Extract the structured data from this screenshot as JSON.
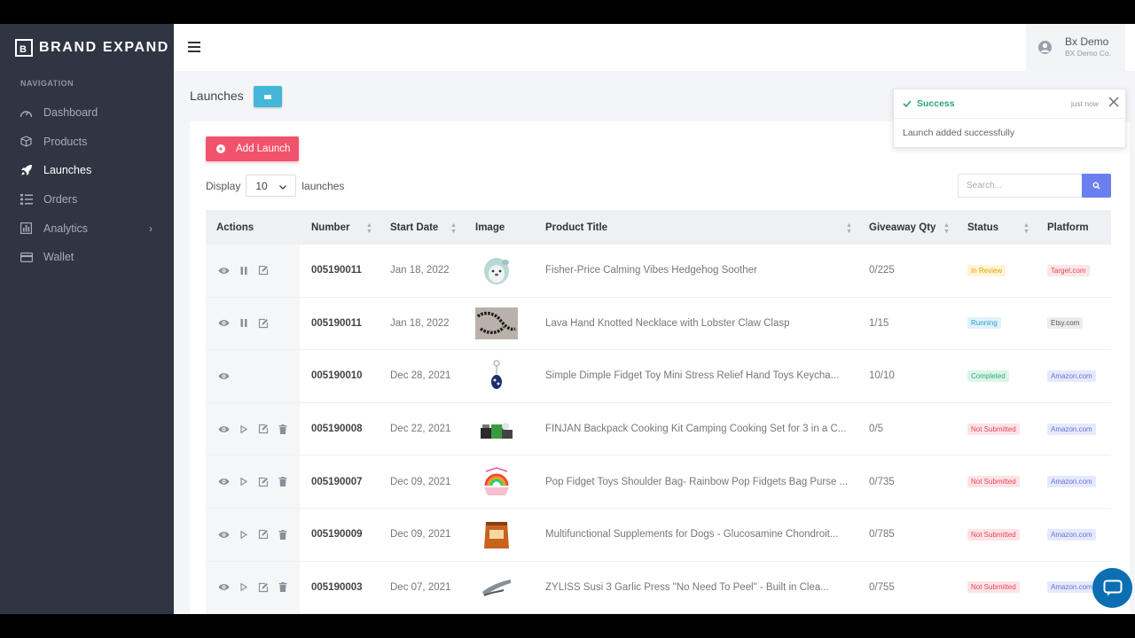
{
  "brand": {
    "name": "BRAND EXPAND",
    "mark": "B"
  },
  "sidebar": {
    "heading": "NAVIGATION",
    "items": [
      {
        "label": "Dashboard",
        "icon": "gauge-icon"
      },
      {
        "label": "Products",
        "icon": "box-icon"
      },
      {
        "label": "Launches",
        "icon": "rocket-icon",
        "active": true
      },
      {
        "label": "Orders",
        "icon": "list-icon"
      },
      {
        "label": "Analytics",
        "icon": "chart-icon",
        "has_children": true
      },
      {
        "label": "Wallet",
        "icon": "credit-card-icon"
      }
    ]
  },
  "user": {
    "name": "Bx Demo",
    "company": "BX Demo Co."
  },
  "page": {
    "title": "Launches"
  },
  "toolbar": {
    "add_label": "Add Launch",
    "display_label": "Display",
    "display_value": "10",
    "display_suffix": "launches",
    "search_placeholder": "Search..."
  },
  "table": {
    "columns": [
      "Actions",
      "Number",
      "Start Date",
      "Image",
      "Product Title",
      "Giveaway Qty",
      "Status",
      "Platform"
    ],
    "rows": [
      {
        "actions": [
          "eye",
          "pause",
          "edit"
        ],
        "number": "005190011",
        "date": "Jan 18, 2022",
        "image": "hedgehog-plush",
        "title": "Fisher-Price Calming Vibes Hedgehog Soother",
        "qty": "0/225",
        "status": "In Review",
        "platform": "Target.com"
      },
      {
        "actions": [
          "eye",
          "pause",
          "edit"
        ],
        "number": "005190011",
        "date": "Jan 18, 2022",
        "image": "necklace",
        "title": "Lava Hand Knotted Necklace with Lobster Claw Clasp",
        "qty": "1/15",
        "status": "Running",
        "platform": "Etsy.com"
      },
      {
        "actions": [
          "eye"
        ],
        "number": "005190010",
        "date": "Dec 28, 2021",
        "image": "fidget-keychain",
        "title": "Simple Dimple Fidget Toy Mini Stress Relief Hand Toys Keycha...",
        "qty": "10/10",
        "status": "Completed",
        "platform": "Amazon.com"
      },
      {
        "actions": [
          "eye",
          "play",
          "edit",
          "trash"
        ],
        "number": "005190008",
        "date": "Dec 22, 2021",
        "image": "cooking-kit",
        "title": "FINJAN Backpack Cooking Kit Camping Cooking Set for 3 in a C...",
        "qty": "0/5",
        "status": "Not Submitted",
        "platform": "Amazon.com"
      },
      {
        "actions": [
          "eye",
          "play",
          "edit",
          "trash"
        ],
        "number": "005190007",
        "date": "Dec 09, 2021",
        "image": "rainbow-bag",
        "title": "Pop Fidget Toys Shoulder Bag- Rainbow Pop Fidgets Bag Purse ...",
        "qty": "0/735",
        "status": "Not Submitted",
        "platform": "Amazon.com"
      },
      {
        "actions": [
          "eye",
          "play",
          "edit",
          "trash"
        ],
        "number": "005190009",
        "date": "Dec 09, 2021",
        "image": "supplement-bag",
        "title": "Multifunctional Supplements for Dogs - Glucosamine Chondroit...",
        "qty": "0/785",
        "status": "Not Submitted",
        "platform": "Amazon.com"
      },
      {
        "actions": [
          "eye",
          "play",
          "edit",
          "trash"
        ],
        "number": "005190003",
        "date": "Dec 07, 2021",
        "image": "garlic-press",
        "title": "ZYLISS Susi 3 Garlic Press \"No Need To Peel\" - Built in Clea...",
        "qty": "0/755",
        "status": "Not Submitted",
        "platform": "Amazon.com"
      }
    ]
  },
  "status_colors": {
    "In Review": {
      "bg": "#fff4d6",
      "fg": "#e0a800"
    },
    "Running": {
      "bg": "#e0f2fb",
      "fg": "#2b9fd6"
    },
    "Completed": {
      "bg": "#dcf5ea",
      "fg": "#2cae74"
    },
    "Not Submitted": {
      "bg": "#fde3e6",
      "fg": "#e8485f"
    }
  },
  "platform_colors": {
    "Target.com": {
      "bg": "#fde6e8",
      "fg": "#e04b5c"
    },
    "Etsy.com": {
      "bg": "#ececec",
      "fg": "#555555"
    },
    "Amazon.com": {
      "bg": "#e6e9fb",
      "fg": "#6673de"
    }
  },
  "toast": {
    "title": "Success",
    "time": "just now",
    "message": "Launch added successfully"
  }
}
